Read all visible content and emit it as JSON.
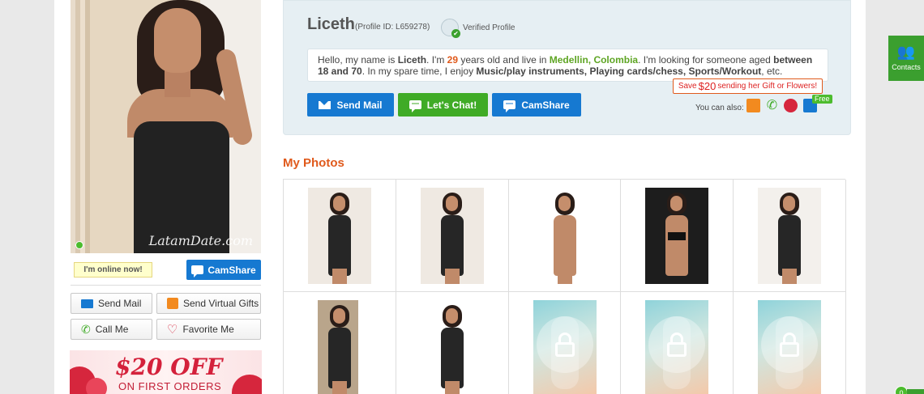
{
  "left": {
    "watermark": "LatamDate.com",
    "online_tag": "I'm online now!",
    "camshare_label": "CamShare",
    "send_mail_label": "Send Mail",
    "send_gifts_label": "Send Virtual Gifts",
    "call_me_label": "Call Me",
    "favorite_label": "Favorite Me",
    "banner_big": "$20 OFF",
    "banner_small": "ON FIRST ORDERS"
  },
  "profile": {
    "name": "Liceth",
    "profile_id": "(Profile ID: L659278)",
    "verified_label": "Verified Profile",
    "bio": {
      "p1": "Hello, my name is ",
      "name": "Liceth",
      "p2": ". I'm ",
      "age": "29",
      "p3": " years old and live in ",
      "city": "Medellin, Colombia",
      "p4": ". I'm looking for someone aged ",
      "range": "between 18 and 70",
      "p5": ". In my spare time, I enjoy ",
      "hobbies": "Music/play instruments, Playing cards/chess, Sports/Workout",
      "p6": ", etc."
    },
    "send_mail_label": "Send Mail",
    "chat_label": "Let's Chat!",
    "camshare_label": "CamShare",
    "save_prefix": "Save",
    "save_amount": "$20",
    "save_suffix": "sending her Gift or Flowers!",
    "can_also_label": "You can also:",
    "free_badge": "Free"
  },
  "photos": {
    "title": "My Photos",
    "items": [
      {
        "locked": false
      },
      {
        "locked": false
      },
      {
        "locked": false
      },
      {
        "locked": false
      },
      {
        "locked": false
      },
      {
        "locked": false
      },
      {
        "locked": false
      },
      {
        "locked": true
      },
      {
        "locked": true
      },
      {
        "locked": true
      }
    ]
  },
  "sidebar": {
    "contacts_label": "Contacts",
    "counter": "0"
  },
  "colors": {
    "accent_orange": "#e05a1c",
    "button_blue": "#1679d1",
    "button_green": "#3fab26",
    "city_green": "#5ea523"
  }
}
